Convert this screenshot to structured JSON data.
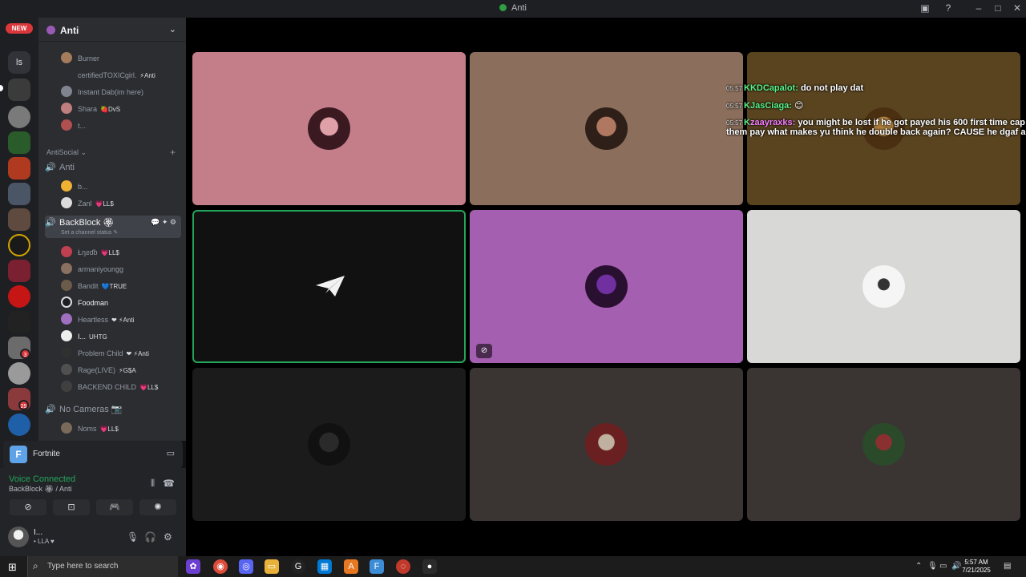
{
  "window": {
    "title": "Anti"
  },
  "servers": {
    "new_badge": "NEW",
    "dm_label": "ls",
    "badges": [
      "3",
      "25"
    ]
  },
  "guild": {
    "name": "Anti"
  },
  "text_users": [
    {
      "name": "Burner",
      "tag": ""
    },
    {
      "name": "certifiedTOXICgirl.",
      "tag": "⚡Anti"
    },
    {
      "name": "Instant Dab(im here)",
      "tag": ""
    },
    {
      "name": "Shara",
      "tag": "🍓DvS"
    },
    {
      "name": "t...",
      "tag": ""
    }
  ],
  "category": {
    "name": "AntiSocial",
    "add": "+"
  },
  "channel_anti": {
    "name": "Anti",
    "users": [
      {
        "name": "b...",
        "tag": ""
      },
      {
        "name": "Zanl",
        "tag": "💗LL$"
      }
    ]
  },
  "channel_backblock": {
    "name": "BackBlock 🏵",
    "status": "Set a channel status ✎",
    "users": [
      {
        "name": "Łŋƨɗɓ",
        "tag": "💗LL$"
      },
      {
        "name": "armaniyoungg",
        "tag": ""
      },
      {
        "name": "Bandit",
        "tag": "💙TRUE"
      },
      {
        "name": "Foodman",
        "tag": ""
      },
      {
        "name": "Heartless",
        "tag": "❤ ⚡Anti"
      },
      {
        "name": "I...",
        "tag": "UHTG"
      },
      {
        "name": "Problem Child",
        "tag": "❤ ⚡Anti"
      },
      {
        "name": "Rage(LIVE)",
        "tag": "⚡G$A"
      },
      {
        "name": "BACKEND CHILD",
        "tag": "💗LL$"
      }
    ]
  },
  "channel_nocam": {
    "name": "No Cameras 📷",
    "users": [
      {
        "name": "Noms",
        "tag": "💗LL$"
      }
    ]
  },
  "activity": {
    "game": "Fortnite",
    "icon": "F"
  },
  "voice": {
    "status": "Voice Connected",
    "location": "BackBlock 🏵 / Anti"
  },
  "me": {
    "name": "I...",
    "status": "• LLA ♥"
  },
  "chat_overlay": [
    {
      "time": "05:57",
      "author": "KDCapalot:",
      "text": "do not play dat",
      "line2": ""
    },
    {
      "time": "05:57",
      "author": "JasCiaga:",
      "text": "😊",
      "line2": ""
    },
    {
      "time": "05:57",
      "author": "zaayraxks:",
      "text": "you might be lost if he got payed his 600 first time cap",
      "line2": "them pay what makes yu think he double back again? CAUSE he dgaf and"
    }
  ],
  "taskbar": {
    "search_placeholder": "Type here to search",
    "time": "5:57 AM",
    "date": "7/21/2025"
  },
  "colors": {
    "accent": "#23a55a",
    "mention": "#57f287",
    "tile_colors": [
      "#c47e8a",
      "#8b6e5c",
      "#5a4420",
      "#111111",
      "#a45fb0",
      "#d8d8d6",
      "#1b1b1b",
      "#3a3433",
      "#3a3433"
    ]
  }
}
